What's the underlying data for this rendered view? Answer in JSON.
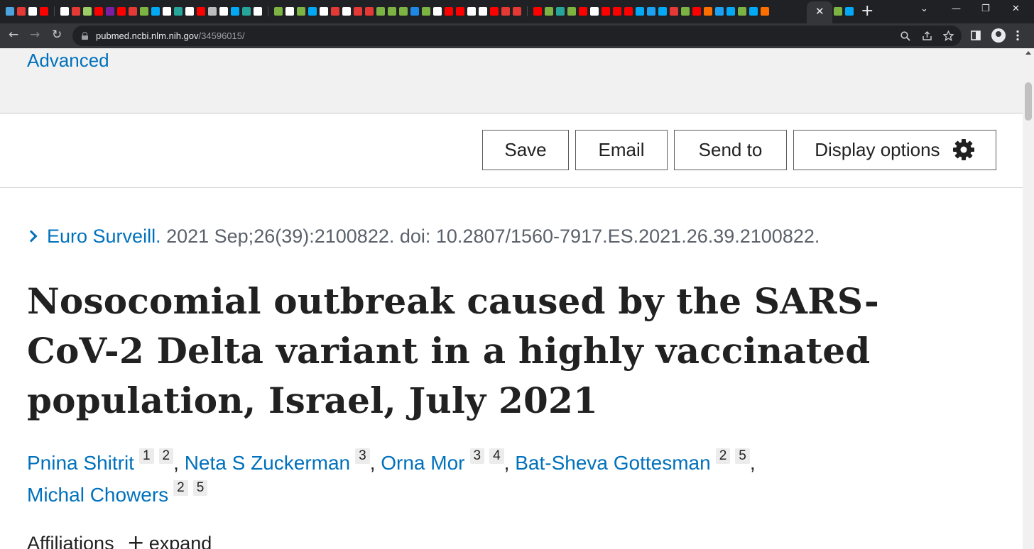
{
  "browser": {
    "tab_favicon_colors": [
      "#4ca3dd",
      "#e53935",
      "#ffffff",
      "#ff0000",
      "#ffffff",
      "#e53935",
      "#9ccc65",
      "#ff0000",
      "#7b1fa2",
      "#ff0000",
      "#e53935",
      "#7cb342",
      "#03a9f4",
      "#ffffff",
      "#26a69a",
      "#ffffff",
      "#ff0000",
      "#bdbdbd",
      "#ffffff",
      "#03a9f4",
      "#26a69a",
      "#ffffff",
      "#7cb342",
      "#ffffff",
      "#7cb342",
      "#03a9f4",
      "#ffffff",
      "#e53935",
      "#ffffff",
      "#e53935",
      "#e53935",
      "#7cb342",
      "#7cb342",
      "#7cb342",
      "#1e88e5",
      "#7cb342",
      "#ffffff",
      "#ff0000",
      "#ff0000",
      "#ffffff",
      "#ffffff",
      "#ff0000",
      "#e53935",
      "#e53935",
      "#ff0000",
      "#7cb342",
      "#26a69a",
      "#7cb342",
      "#ff0000",
      "#ffffff",
      "#ff0000",
      "#ff0000",
      "#ff0000",
      "#03a9f4",
      "#1da1f2",
      "#03a9f4",
      "#e53935",
      "#7cb342",
      "#ff0000",
      "#ff6f00",
      "#1da1f2",
      "#03a9f4",
      "#7cb342",
      "#03a9f4",
      "#ff6f00"
    ],
    "active_tab_close": "✕",
    "new_tab": "+",
    "window_controls": [
      "⌄",
      "—",
      "❐",
      "✕"
    ],
    "url_host": "pubmed.ncbi.nlm.nih.gov",
    "url_path": "/34596015/",
    "nav": {
      "back": "←",
      "forward": "→",
      "reload": "↻"
    },
    "omnibox_icons": [
      "zoom-icon",
      "share-icon",
      "bookmark-star-icon"
    ],
    "toolbar_icons": [
      "side-panel-icon",
      "profile-icon",
      "menu-icon"
    ]
  },
  "page": {
    "search": {
      "advanced_link": "Advanced"
    },
    "actions": {
      "save": "Save",
      "email": "Email",
      "send_to": "Send to",
      "display_options": "Display options"
    },
    "citation": {
      "journal": "Euro Surveill.",
      "details": " 2021 Sep;26(39):2100822. doi: 10.2807/1560-7917.ES.2021.26.39.2100822."
    },
    "title": "Nosocomial outbreak caused by the SARS-CoV-2 Delta variant in a highly vaccinated population, Israel, July 2021",
    "authors": [
      {
        "name": "Pnina Shitrit",
        "affs": [
          "1",
          "2"
        ]
      },
      {
        "name": "Neta S Zuckerman",
        "affs": [
          "3"
        ]
      },
      {
        "name": "Orna Mor",
        "affs": [
          "3",
          "4"
        ]
      },
      {
        "name": "Bat-Sheva Gottesman",
        "affs": [
          "2",
          "5"
        ]
      },
      {
        "name": "Michal Chowers",
        "affs": [
          "2",
          "5"
        ]
      }
    ],
    "affiliations": {
      "label": "Affiliations",
      "expand": "expand"
    }
  },
  "colors": {
    "link": "#0071bc",
    "text": "#212121",
    "muted": "#5b616b",
    "chrome_dark": "#202124",
    "chrome_toolbar": "#35363a"
  }
}
